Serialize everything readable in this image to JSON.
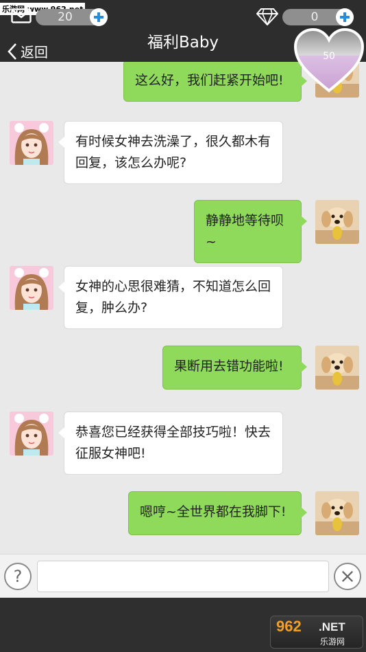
{
  "watermark": "乐游网 www.962.net",
  "header": {
    "mail_count": "20",
    "gem_count": "0",
    "title": "福利Baby",
    "back_label": "返回",
    "heart_value": "50"
  },
  "messages": [
    {
      "side": "out",
      "text": "这么好，我们赶紧开始吧!"
    },
    {
      "side": "in",
      "text": "有时候女神去洗澡了，很久都木有回复，该怎么办呢?"
    },
    {
      "side": "out",
      "text": "静静地等待呗~"
    },
    {
      "side": "in",
      "text": "女神的心思很难猜，不知道怎么回复，肿么办?"
    },
    {
      "side": "out",
      "text": "果断用去错功能啦!"
    },
    {
      "side": "in",
      "text": "恭喜您已经获得全部技巧啦！快去征服女神吧!"
    },
    {
      "side": "out",
      "text": "嗯哼~全世界都在我脚下!"
    }
  ],
  "input": {
    "help_label": "?",
    "value": ""
  },
  "logo": {
    "big": "962",
    "net": ".NET",
    "small": "乐游网"
  },
  "colors": {
    "bar": "#2d2d2d",
    "bubble_out": "#8fda5a",
    "bubble_in": "#ffffff",
    "accent": "#2a8bd6",
    "heart": "#c9a2d2"
  }
}
